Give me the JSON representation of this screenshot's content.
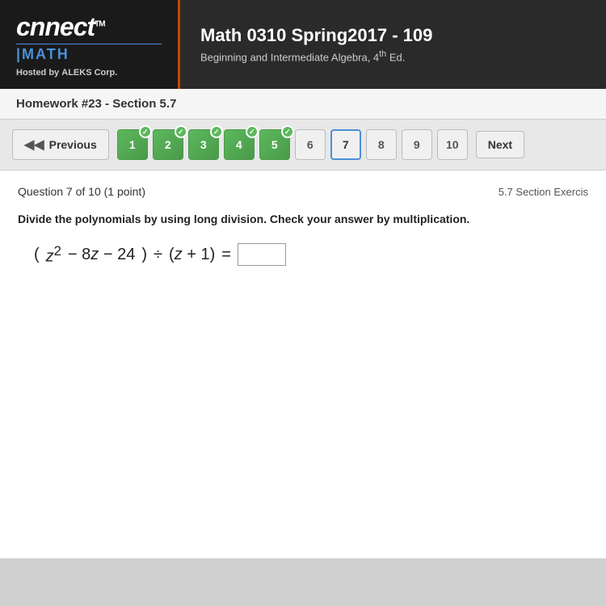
{
  "header": {
    "logo": {
      "connect": "nnect",
      "connect_prefix": "c",
      "tm": "TM",
      "math": "MATH",
      "hosted_by": "Hosted by",
      "company": "ALEKS Corp."
    },
    "course": {
      "title": "Math 0310 Spring2017 - 109",
      "subtitle": "Beginning and Intermediate Algebra, 4",
      "subtitle_sup": "th",
      "subtitle_end": " Ed."
    }
  },
  "hw_bar": {
    "text": "Homework #23 - Section 5.7"
  },
  "navigation": {
    "previous_label": "Previous",
    "next_label": "Next",
    "pages": [
      {
        "num": 1,
        "state": "completed"
      },
      {
        "num": 2,
        "state": "completed"
      },
      {
        "num": 3,
        "state": "completed"
      },
      {
        "num": 4,
        "state": "completed"
      },
      {
        "num": 5,
        "state": "completed"
      },
      {
        "num": 6,
        "state": "plain"
      },
      {
        "num": 7,
        "state": "current"
      },
      {
        "num": 8,
        "state": "plain"
      },
      {
        "num": 9,
        "state": "plain"
      },
      {
        "num": 10,
        "state": "plain"
      }
    ]
  },
  "question": {
    "info": "Question 7 of 10 (1 point)",
    "section_ref": "5.7 Section Exercis",
    "instruction": "Divide the polynomials by using long division. Check your answer by multiplication.",
    "math_display": "(z² − 8z − 24) ÷ (z + 1) =",
    "answer_placeholder": ""
  }
}
